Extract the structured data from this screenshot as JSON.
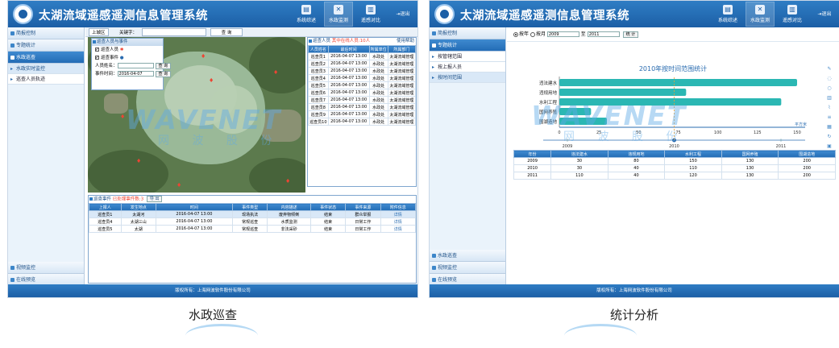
{
  "left": {
    "app_title": "太湖流域遥感遥测信息管理系统",
    "top_buttons": [
      {
        "label": "系统综述",
        "icon": "book-icon"
      },
      {
        "label": "水政监测",
        "icon": "tools-icon"
      },
      {
        "label": "遥感对比",
        "icon": "compare-icon"
      }
    ],
    "exit_label": "退出",
    "menu_groups": [
      "简报控制",
      "专题统计",
      "水政巡查"
    ],
    "menu_items": [
      "水政实时监控",
      "巡查人员轨迹"
    ],
    "bottom_groups": [
      "视频监控",
      "在线预览"
    ],
    "toolbar": {
      "dropdown": "上城区",
      "keyword_label": "关键字：",
      "search": "查 询"
    },
    "filter_panel": {
      "title": "巡查人员与事件",
      "opt1": "巡查人员",
      "opt2": "巡查事件",
      "name_label": "人员姓名：",
      "name_btn": "查 询",
      "date_label": "事件时间：",
      "date_value": "2016-04-07",
      "date_btn": "查 询"
    },
    "staff_panel": {
      "title": "巡查人员",
      "note": "其中在线人员:10人",
      "guide": "使用帮助",
      "columns": [
        "人员姓名",
        "最后时间",
        "所属单位",
        "所属部门"
      ],
      "rows": [
        [
          "巡查员1",
          "2016-04-07 13:00",
          "水政处",
          "太湖流域管理"
        ],
        [
          "巡查员2",
          "2016-04-07 13:00",
          "水政处",
          "太湖流域管理"
        ],
        [
          "巡查员3",
          "2016-04-07 13:00",
          "水政处",
          "太湖流域管理"
        ],
        [
          "巡查员4",
          "2016-04-07 13:00",
          "水政处",
          "太湖流域管理"
        ],
        [
          "巡查员5",
          "2016-04-07 13:00",
          "水政处",
          "太湖流域管理"
        ],
        [
          "巡查员6",
          "2016-04-07 13:00",
          "水政处",
          "太湖流域管理"
        ],
        [
          "巡查员7",
          "2016-04-07 13:00",
          "水政处",
          "太湖流域管理"
        ],
        [
          "巡查员8",
          "2016-04-07 13:00",
          "水政处",
          "太湖流域管理"
        ],
        [
          "巡查员9",
          "2016-04-07 13:00",
          "水政处",
          "太湖流域管理"
        ],
        [
          "巡查员10",
          "2016-04-07 13:00",
          "水政处",
          "太湖流域管理"
        ]
      ]
    },
    "event_panel": {
      "title": "巡查事件",
      "note": "已处理事件数:3",
      "export": "导 出",
      "columns": [
        "上报人",
        "发生地点",
        "时间",
        "事件类型",
        "内容描述",
        "事件状态",
        "事件来源",
        "附件信息"
      ],
      "rows": [
        [
          "巡查员1",
          "太湖河",
          "2016-04-07 13:00",
          "现场执法",
          "废弃物倾倒",
          "结束",
          "群众举报",
          "详情"
        ],
        [
          "巡查员4",
          "太湖三山",
          "2016-04-07 13:00",
          "常规巡查",
          "水质监测",
          "结束",
          "日常工作",
          "详情"
        ],
        [
          "巡查员5",
          "太湖",
          "2016-04-07 13:00",
          "常规巡查",
          "非法采砂",
          "结束",
          "日常工作",
          "详情"
        ]
      ]
    },
    "footer": "版权所有：上海网波软件股份有限公司",
    "caption": "水政巡查"
  },
  "right": {
    "app_title": "太湖流域遥感遥测信息管理系统",
    "top_buttons": [
      {
        "label": "系统综述",
        "icon": "book-icon"
      },
      {
        "label": "水政监测",
        "icon": "tools-icon"
      },
      {
        "label": "遥感对比",
        "icon": "compare-icon"
      }
    ],
    "exit_label": "退出",
    "menu_groups": [
      "简报控制",
      "专题统计"
    ],
    "menu_items": [
      "按管辖范围",
      "按上报人员",
      "按时间范围"
    ],
    "bottom_groups": [
      "水政巡查",
      "视频监控",
      "在线预览"
    ],
    "filter": {
      "opt1": "按年",
      "opt2": "按月",
      "from": "2009",
      "to_label": "至",
      "to": "2011",
      "btn": "统 计"
    },
    "footer": "版权所有：上海网波软件股份有限公司",
    "caption": "统计分析"
  },
  "chart_data": {
    "type": "bar",
    "orientation": "horizontal",
    "title": "2010年按时间范围统计",
    "categories": [
      "违法建水",
      "违规用地",
      "水利工程",
      "国网养殖",
      "围湖造地"
    ],
    "values": [
      150,
      80,
      140,
      20,
      30
    ],
    "xlim": [
      0,
      150
    ],
    "x_ticks": [
      0,
      25,
      50,
      75,
      100,
      125,
      150
    ],
    "xlabel": "",
    "x_unit_label": "平方米",
    "timeline": [
      "2009",
      "2010",
      "2011"
    ],
    "color": "#2bb7b3",
    "table": {
      "columns": [
        "年份",
        "违法建水",
        "违规用地",
        "水利工程",
        "国网养殖",
        "围湖造地"
      ],
      "rows": [
        [
          "2009",
          "30",
          "80",
          "150",
          "130",
          "200"
        ],
        [
          "2010",
          "30",
          "40",
          "110",
          "130",
          "200"
        ],
        [
          "2011",
          "110",
          "40",
          "120",
          "130",
          "200"
        ]
      ]
    }
  },
  "watermark": {
    "brand": "WAVENET",
    "cn": "网 波 股 份"
  },
  "colors": {
    "header": "#1c5fa6",
    "accent": "#2f7dc4",
    "bar": "#2bb7b3"
  }
}
